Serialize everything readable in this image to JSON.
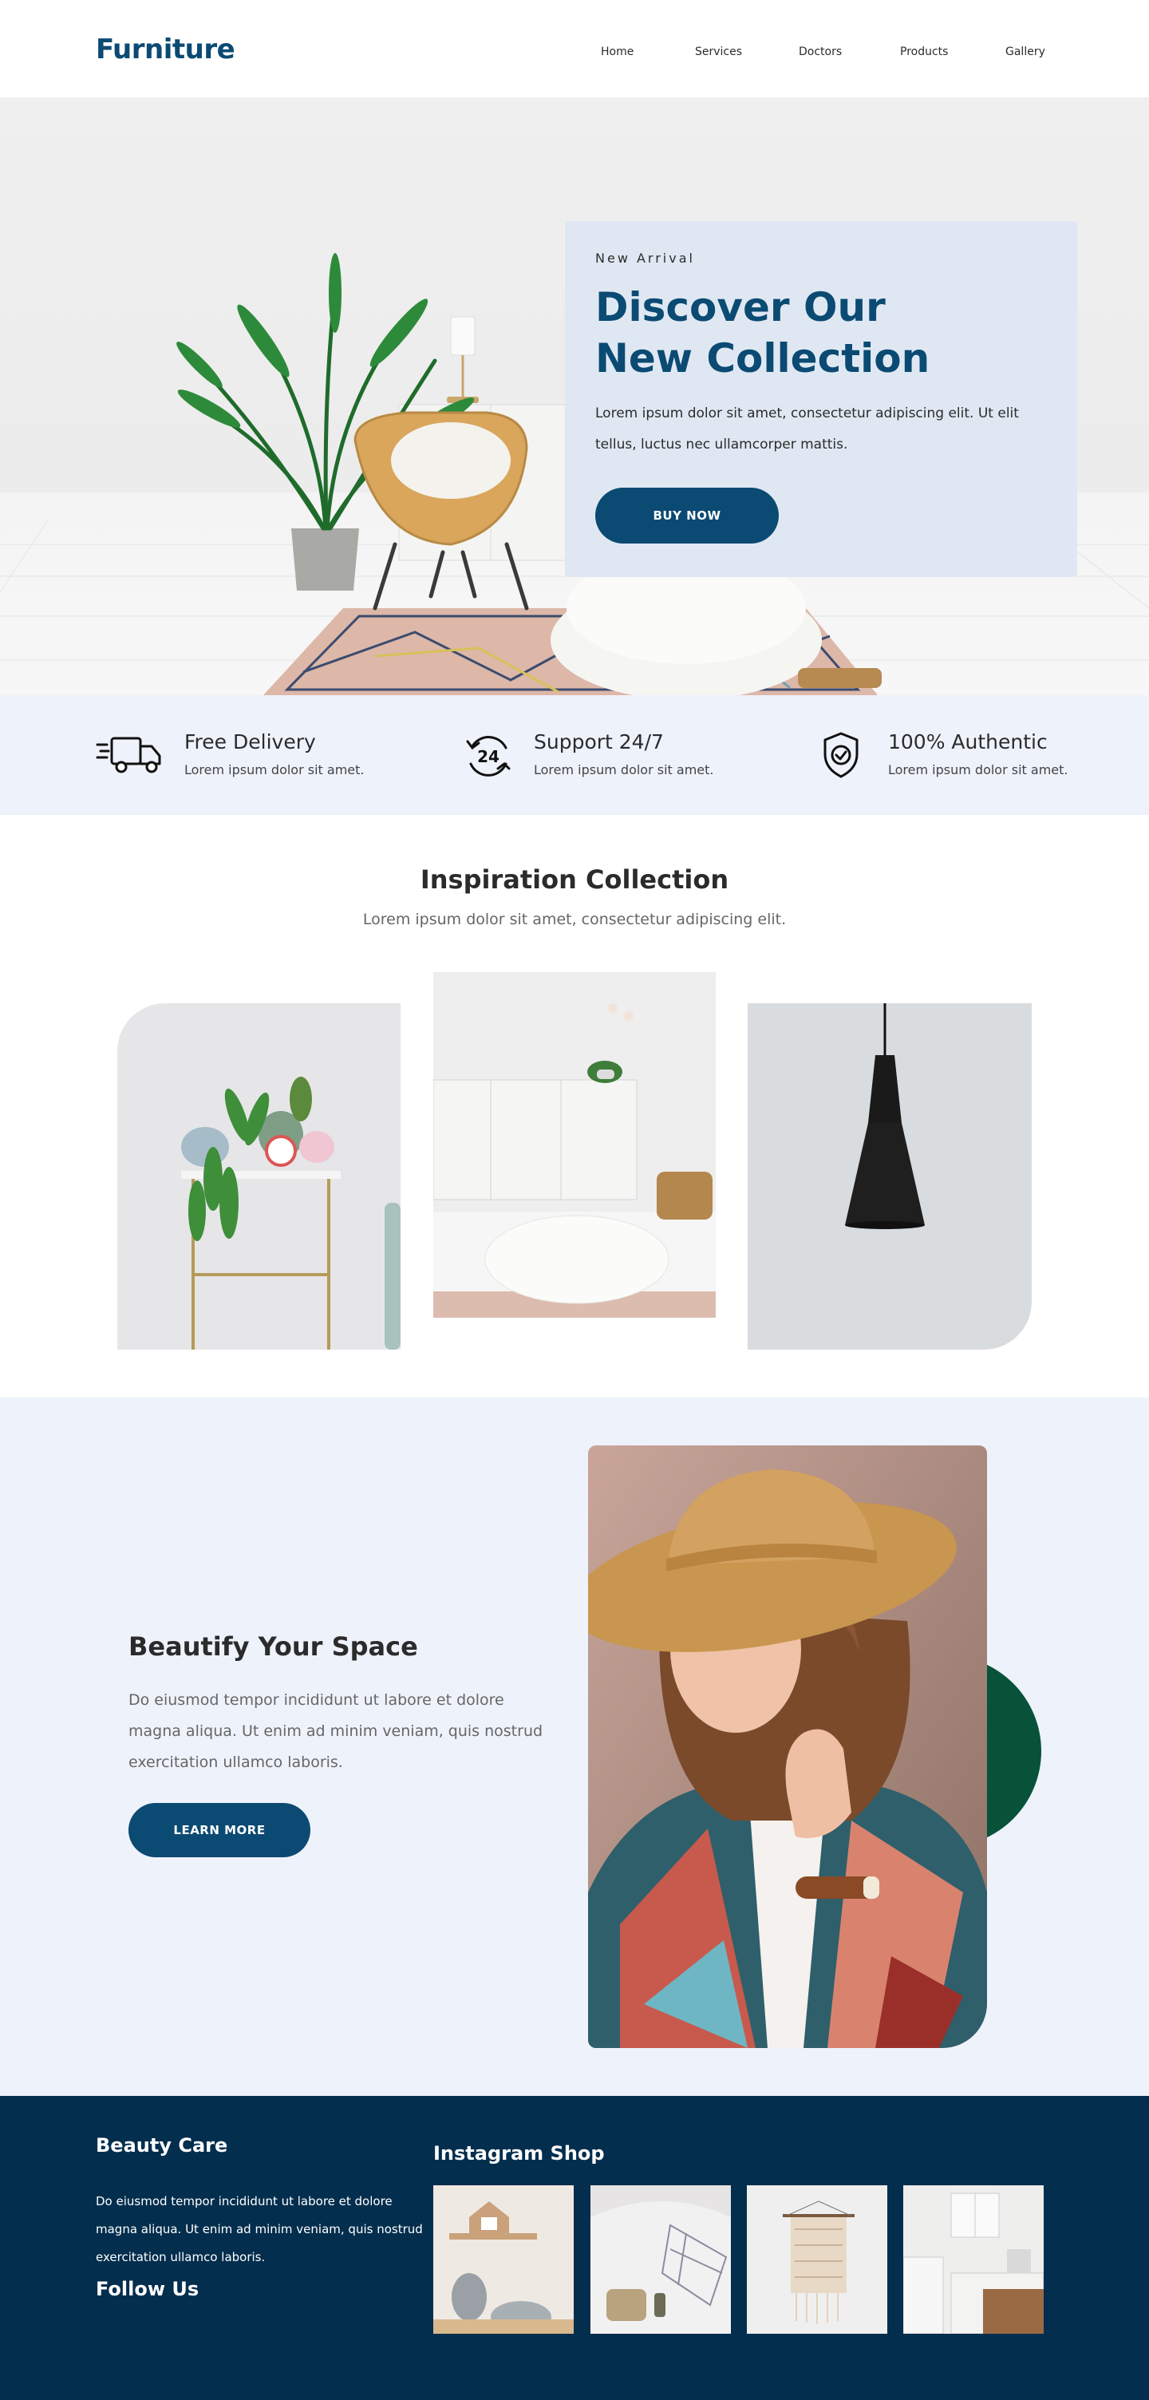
{
  "header": {
    "logo": "Furniture",
    "nav": [
      "Home",
      "Services",
      "Doctors",
      "Products",
      "Gallery"
    ]
  },
  "hero": {
    "eyebrow": "New Arrival",
    "title_line1": "Discover Our",
    "title_line2": "New Collection",
    "text": "Lorem ipsum dolor sit amet, consectetur adipiscing elit. Ut elit tellus, luctus nec ullamcorper mattis.",
    "button": "BUY NOW"
  },
  "features": [
    {
      "icon": "delivery-truck-icon",
      "title": "Free Delivery",
      "text": "Lorem ipsum dolor sit amet."
    },
    {
      "icon": "support-24-7-icon",
      "title": "Support 24/7",
      "text": "Lorem ipsum dolor sit amet."
    },
    {
      "icon": "shield-check-icon",
      "title": "100% Authentic",
      "text": "Lorem ipsum dolor sit amet."
    }
  ],
  "inspiration": {
    "title": "Inspiration Collection",
    "subtitle": "Lorem ipsum dolor sit amet, consectetur adipiscing elit."
  },
  "beautify": {
    "title": "Beautify Your Space",
    "text": "Do eiusmod tempor incididunt ut labore et dolore magna aliqua. Ut enim ad minim veniam, quis nostrud exercitation ullamco laboris.",
    "button": "LEARN MORE"
  },
  "footer": {
    "col1_title": "Beauty Care",
    "col1_text": "Do eiusmod tempor incididunt ut labore et dolore magna aliqua. Ut enim ad minim veniam, quis nostrud exercitation ullamco laboris.",
    "follow_title": "Follow Us",
    "insta_title": "Instagram Shop"
  },
  "colors": {
    "brand": "#0b4a73",
    "hero_card": "#dfe8f2",
    "light_section": "#eef2fb",
    "footer": "#032e4e",
    "accent_green": "#075238"
  }
}
